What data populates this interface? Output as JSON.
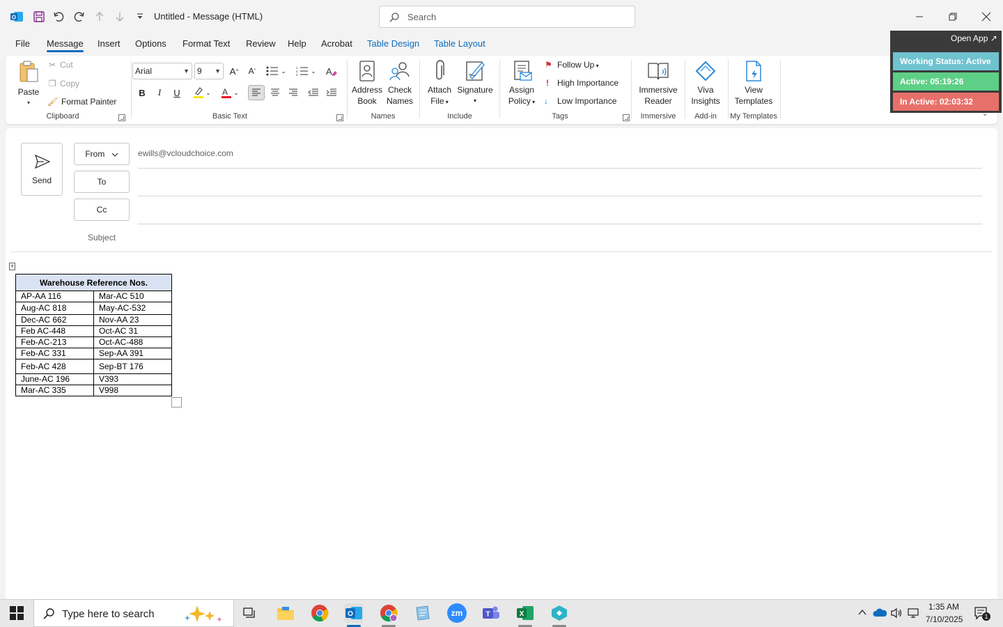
{
  "window": {
    "title": "Untitled  -  Message (HTML)",
    "search_placeholder": "Search"
  },
  "menu": {
    "tabs": [
      "File",
      "Message",
      "Insert",
      "Options",
      "Format Text",
      "Review",
      "Help",
      "Acrobat",
      "Table Design",
      "Table Layout"
    ]
  },
  "ribbon": {
    "clipboard": {
      "paste": "Paste",
      "cut": "Cut",
      "copy": "Copy",
      "format_painter": "Format Painter",
      "label": "Clipboard"
    },
    "basic_text": {
      "font": "Arial",
      "size": "9",
      "label": "Basic Text"
    },
    "names": {
      "address_book_1": "Address",
      "address_book_2": "Book",
      "check_names_1": "Check",
      "check_names_2": "Names",
      "label": "Names"
    },
    "include": {
      "attach_1": "Attach",
      "attach_2": "File",
      "signature": "Signature",
      "label": "Include"
    },
    "tags": {
      "assign_1": "Assign",
      "assign_2": "Policy",
      "follow_up": "Follow Up",
      "high": "High Importance",
      "low": "Low Importance",
      "label": "Tags"
    },
    "immersive": {
      "reader_1": "Immersive",
      "reader_2": "Reader",
      "label": "Immersive"
    },
    "addin": {
      "viva_1": "Viva",
      "viva_2": "Insights",
      "label": "Add-in"
    },
    "templates": {
      "view_1": "View",
      "view_2": "Templates",
      "label": "My Templates"
    }
  },
  "widget": {
    "open_app": "Open App ↗",
    "working_status": "Working Status: Active",
    "active": "Active: 05:19:26",
    "inactive": "In Active: 02:03:32",
    "colors": {
      "working": "#6fc3cf",
      "active": "#5ecf86",
      "inactive": "#e8706a"
    }
  },
  "compose": {
    "send": "Send",
    "from_label": "From",
    "from_email": "ewills@vcloudchoice.com",
    "to_label": "To",
    "cc_label": "Cc",
    "subject_label": "Subject"
  },
  "table": {
    "header": "Warehouse Reference Nos.",
    "rows": [
      [
        "AP-AA 116",
        "Mar-AC 510"
      ],
      [
        "Aug-AC 818",
        "May-AC-532"
      ],
      [
        "Dec-AC 662",
        "Nov-AA 23"
      ],
      [
        "Feb AC-448",
        "Oct-AC 31"
      ],
      [
        "Feb-AC-213",
        "Oct-AC-488"
      ],
      [
        "Feb-AC 331",
        "Sep-AA 391"
      ],
      [
        "Feb-AC 428",
        "Sep-BT 176"
      ],
      [
        "June-AC 196",
        "V393"
      ],
      [
        "Mar-AC 335",
        "V998"
      ]
    ]
  },
  "taskbar": {
    "search_placeholder": "Type here to search",
    "time": "1:35 AM",
    "date": "7/10/2025",
    "notif_count": "1"
  }
}
